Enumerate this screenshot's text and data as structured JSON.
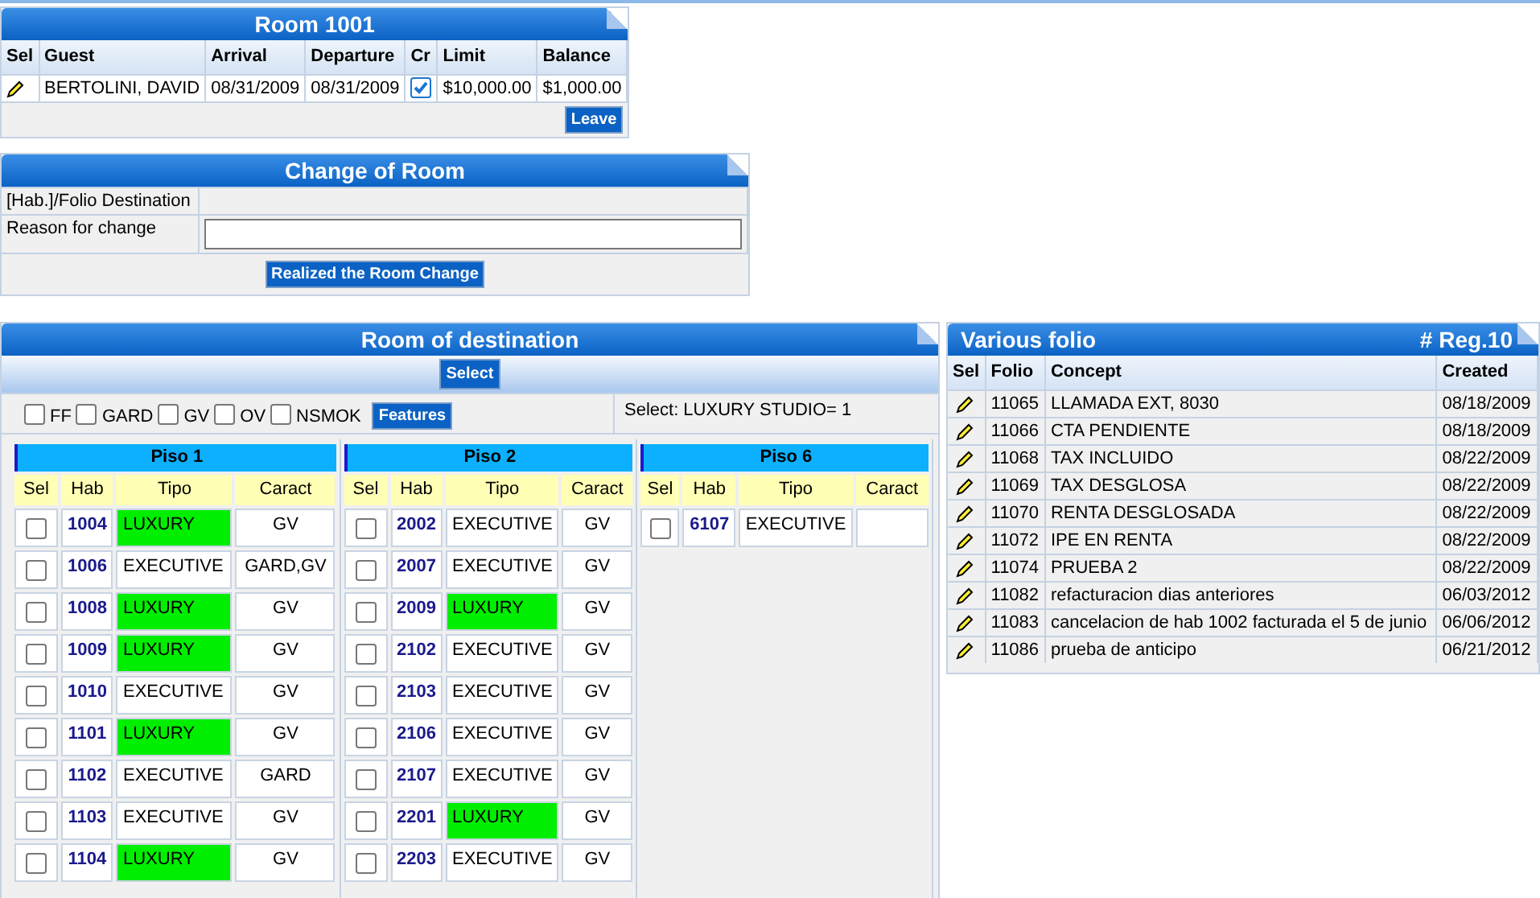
{
  "room": {
    "title": "Room 1001",
    "columns": [
      "Sel",
      "Guest",
      "Arrival",
      "Departure",
      "Cr",
      "Limit",
      "Balance"
    ],
    "rows": [
      {
        "guest": "BERTOLINI, DAVID",
        "arrival": "08/31/2009",
        "departure": "08/31/2009",
        "credit": true,
        "limit": "$10,000.00",
        "balance": "$1,000.00"
      }
    ],
    "leave_button": "Leave"
  },
  "change": {
    "title": "Change of Room",
    "fields": [
      {
        "label": "[Hab.]/Folio Destination",
        "kind": "text"
      },
      {
        "label": "Reason for change",
        "kind": "input"
      }
    ],
    "button": "Realized the Room Change"
  },
  "destination": {
    "title": "Room of destination",
    "select_button": "Select",
    "filters": [
      {
        "label": "FF",
        "checked": false
      },
      {
        "label": "GARD",
        "checked": false
      },
      {
        "label": "GV",
        "checked": false
      },
      {
        "label": "OV",
        "checked": false
      },
      {
        "label": "NSMOK",
        "checked": false
      }
    ],
    "features_button": "Features",
    "selection_text": "Select: LUXURY STUDIO= 1",
    "floors": [
      {
        "title": "Piso 1",
        "columns": [
          "Sel",
          "Hab",
          "Tipo",
          "Caract"
        ],
        "rooms": [
          {
            "selected": false,
            "hab": "1004",
            "tipo": "LUXURY",
            "highlighted": true,
            "caract": "GV"
          },
          {
            "selected": false,
            "hab": "1006",
            "tipo": "EXECUTIVE",
            "highlighted": false,
            "caract": "GARD,GV"
          },
          {
            "selected": false,
            "hab": "1008",
            "tipo": "LUXURY",
            "highlighted": true,
            "caract": "GV"
          },
          {
            "selected": false,
            "hab": "1009",
            "tipo": "LUXURY",
            "highlighted": true,
            "caract": "GV"
          },
          {
            "selected": false,
            "hab": "1010",
            "tipo": "EXECUTIVE",
            "highlighted": false,
            "caract": "GV"
          },
          {
            "selected": false,
            "hab": "1101",
            "tipo": "LUXURY",
            "highlighted": true,
            "caract": "GV"
          },
          {
            "selected": false,
            "hab": "1102",
            "tipo": "EXECUTIVE",
            "highlighted": false,
            "caract": "GARD"
          },
          {
            "selected": false,
            "hab": "1103",
            "tipo": "EXECUTIVE",
            "highlighted": false,
            "caract": "GV"
          },
          {
            "selected": false,
            "hab": "1104",
            "tipo": "LUXURY",
            "highlighted": true,
            "caract": "GV"
          }
        ]
      },
      {
        "title": "Piso 2",
        "columns": [
          "Sel",
          "Hab",
          "Tipo",
          "Caract"
        ],
        "rooms": [
          {
            "selected": false,
            "hab": "2002",
            "tipo": "EXECUTIVE",
            "highlighted": false,
            "caract": "GV"
          },
          {
            "selected": false,
            "hab": "2007",
            "tipo": "EXECUTIVE",
            "highlighted": false,
            "caract": "GV"
          },
          {
            "selected": false,
            "hab": "2009",
            "tipo": "LUXURY",
            "highlighted": true,
            "caract": "GV"
          },
          {
            "selected": false,
            "hab": "2102",
            "tipo": "EXECUTIVE",
            "highlighted": false,
            "caract": "GV"
          },
          {
            "selected": false,
            "hab": "2103",
            "tipo": "EXECUTIVE",
            "highlighted": false,
            "caract": "GV"
          },
          {
            "selected": false,
            "hab": "2106",
            "tipo": "EXECUTIVE",
            "highlighted": false,
            "caract": "GV"
          },
          {
            "selected": false,
            "hab": "2107",
            "tipo": "EXECUTIVE",
            "highlighted": false,
            "caract": "GV"
          },
          {
            "selected": false,
            "hab": "2201",
            "tipo": "LUXURY",
            "highlighted": true,
            "caract": "GV"
          },
          {
            "selected": false,
            "hab": "2203",
            "tipo": "EXECUTIVE",
            "highlighted": false,
            "caract": "GV"
          }
        ]
      },
      {
        "title": "Piso 6",
        "columns": [
          "Sel",
          "Hab",
          "Tipo",
          "Caract"
        ],
        "rooms": [
          {
            "selected": false,
            "hab": "6107",
            "tipo": "EXECUTIVE",
            "highlighted": false
          }
        ]
      }
    ]
  },
  "folios": {
    "title": "Various folio",
    "count": "# Reg.10",
    "columns": [
      "Sel",
      "Folio",
      "Concept",
      "Created"
    ],
    "rows": [
      {
        "folio": "11065",
        "concept": "LLAMADA EXT, 8030",
        "created": "08/18/2009"
      },
      {
        "folio": "11066",
        "concept": "CTA PENDIENTE",
        "created": "08/18/2009"
      },
      {
        "folio": "11068",
        "concept": "TAX INCLUIDO",
        "created": "08/22/2009"
      },
      {
        "folio": "11069",
        "concept": "TAX DESGLOSA",
        "created": "08/22/2009"
      },
      {
        "folio": "11070",
        "concept": "RENTA DESGLOSADA",
        "created": "08/22/2009"
      },
      {
        "folio": "11072",
        "concept": "IPE EN RENTA",
        "created": "08/22/2009"
      },
      {
        "folio": "11074",
        "concept": "PRUEBA 2",
        "created": "08/22/2009"
      },
      {
        "folio": "11082",
        "concept": "refacturacion dias anteriores",
        "created": "06/03/2012"
      },
      {
        "folio": "11083",
        "concept": "cancelacion de hab 1002 facturada el 5 de junio",
        "created": "06/06/2012"
      },
      {
        "folio": "11086",
        "concept": "prueba de anticipo",
        "created": "06/21/2012"
      }
    ]
  }
}
